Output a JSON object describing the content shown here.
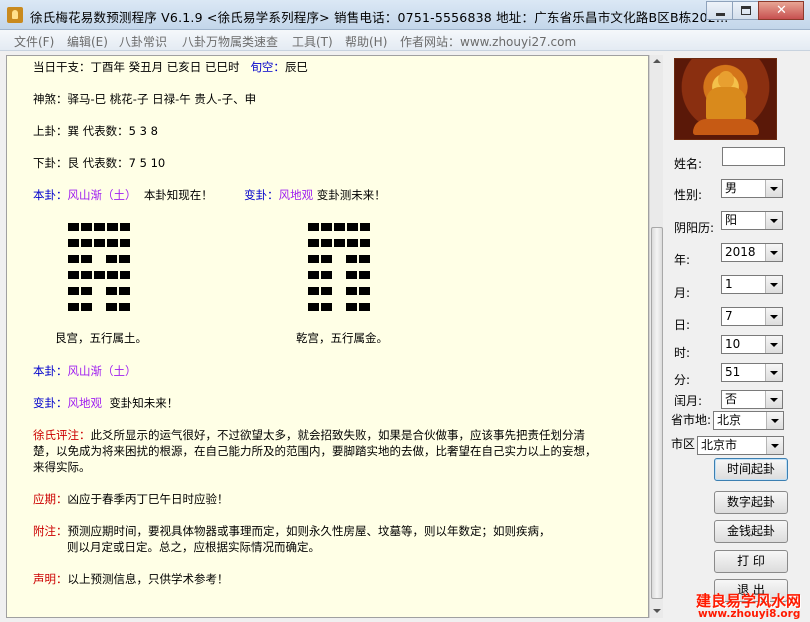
{
  "window": {
    "title": "徐氏梅花易数预测程序 V6.1.9 <徐氏易学系列程序>   销售电话：0751-5556838   地址：广东省乐昌市文化路B区B栋202..."
  },
  "menu": [
    "文件(F)",
    "编辑(E)",
    "八卦常识",
    "八卦万物属类速查",
    "工具(T)",
    "帮助(H)",
    "作者网站：www.zhouyi27.com"
  ],
  "content": {
    "line_ganzhi": "当日干支：丁酉年 癸丑月 已亥日 已巳时",
    "line_ganzhi_xunkong_label": "旬空：",
    "line_ganzhi_xunkong": "辰巳",
    "shensha_label": "神煞：",
    "shensha": "驿马-巳  桃花-子  日禄-午  贵人-子、申",
    "shanggua": "上卦：巽 代表数：5 3 8",
    "xiagua": "下卦：艮 代表数：7 5 10",
    "bengua_label": "本卦：",
    "bengua_name": "风山渐（土）",
    "bengua_note": "本卦知现在！",
    "biangua_label": "变卦：",
    "biangua_name": "风地观",
    "biangua_note": "变卦测未来！",
    "left_palace": "艮宫，五行属土。",
    "right_palace": "乾宫，五行属金。",
    "bengua2_label": "本卦：",
    "bengua2_name": "风山渐（土）",
    "biangua2_label": "变卦：",
    "biangua2_name": "风地观",
    "biangua2_note": "变卦知未来！",
    "comment_label": "徐氏评注：",
    "comment_1": "此爻所显示的运气很好，不过欲望太多，就会招致失败，如果是合伙做事，应该事先把责任划分清",
    "comment_2": "楚，以免成为将来困扰的根源，在自己能力所及的范围内，要脚踏实地的去做，比奢望在自己实力以上的妄想，",
    "comment_3": "来得实际。",
    "yingqi_label": "应期：",
    "yingqi": "凶应于春季丙丁巳午日时应验！",
    "fuzhu_label": "附注：",
    "fuzhu_1": "预测应期时间，要视具体物器或事理而定，如则永久性房屋、坟墓等，则以年数定；如则疾病，",
    "fuzhu_2": "则以月定或日定。总之，应根据实际情况而确定。",
    "shengming_label": "声明：",
    "shengming": "以上预测信息，只供学术参考！"
  },
  "hexagrams": {
    "left": [
      "yang",
      "yang",
      "yin",
      "yang",
      "yin",
      "yin"
    ],
    "right": [
      "yang",
      "yang",
      "yin",
      "yin",
      "yin",
      "yin"
    ]
  },
  "form": {
    "name_label": "姓名:",
    "gender_label": "性别:",
    "gender_value": "男",
    "calendar_label": "阴阳历:",
    "calendar_value": "阳",
    "year_label": "年:",
    "year_value": "2018",
    "month_label": "月:",
    "month_value": "1",
    "day_label": "日:",
    "day_value": "7",
    "hour_label": "时:",
    "hour_value": "10",
    "minute_label": "分:",
    "minute_value": "51",
    "leap_label": "闰月:",
    "leap_value": "否",
    "province_label": "省市地:",
    "province_value": "北京",
    "city_label": "市区",
    "city_value": "北京市"
  },
  "buttons": {
    "time": "时间起卦",
    "number": "数字起卦",
    "coin": "金钱起卦",
    "print": "打 印",
    "exit": "退 出"
  },
  "watermark": {
    "main": "建良易学风水网",
    "url": "www.zhouyi8.org"
  }
}
